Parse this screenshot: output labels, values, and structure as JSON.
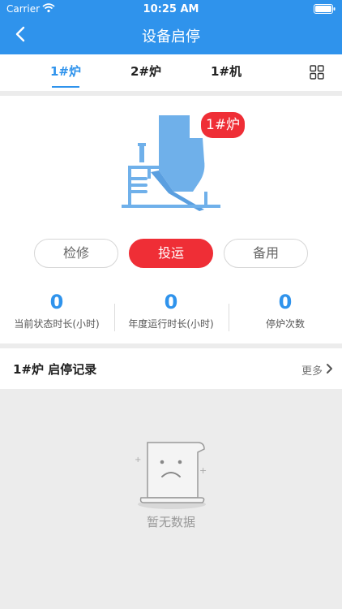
{
  "status_bar": {
    "carrier": "Carrier",
    "time": "10:25 AM"
  },
  "header": {
    "title": "设备启停"
  },
  "tabs": [
    {
      "label": "1#炉",
      "active": true
    },
    {
      "label": "2#炉",
      "active": false
    },
    {
      "label": "1#机",
      "active": false
    }
  ],
  "device": {
    "badge": "1#炉"
  },
  "modes": [
    {
      "label": "检修",
      "active": false
    },
    {
      "label": "投运",
      "active": true
    },
    {
      "label": "备用",
      "active": false
    }
  ],
  "stats": [
    {
      "value": "0",
      "label": "当前状态时长(小时)"
    },
    {
      "value": "0",
      "label": "年度运行时长(小时)"
    },
    {
      "value": "0",
      "label": "停炉次数"
    }
  ],
  "records": {
    "title": "1#炉 启停记录",
    "more": "更多"
  },
  "empty": {
    "text": "暂无数据"
  },
  "colors": {
    "primary": "#2f93ec",
    "accent": "#ef2e36",
    "background": "#ececec"
  },
  "icons": [
    "back-icon",
    "wifi-icon",
    "battery-icon",
    "grid-icon",
    "boiler-icon",
    "chevron-right-icon",
    "empty-document-icon"
  ]
}
